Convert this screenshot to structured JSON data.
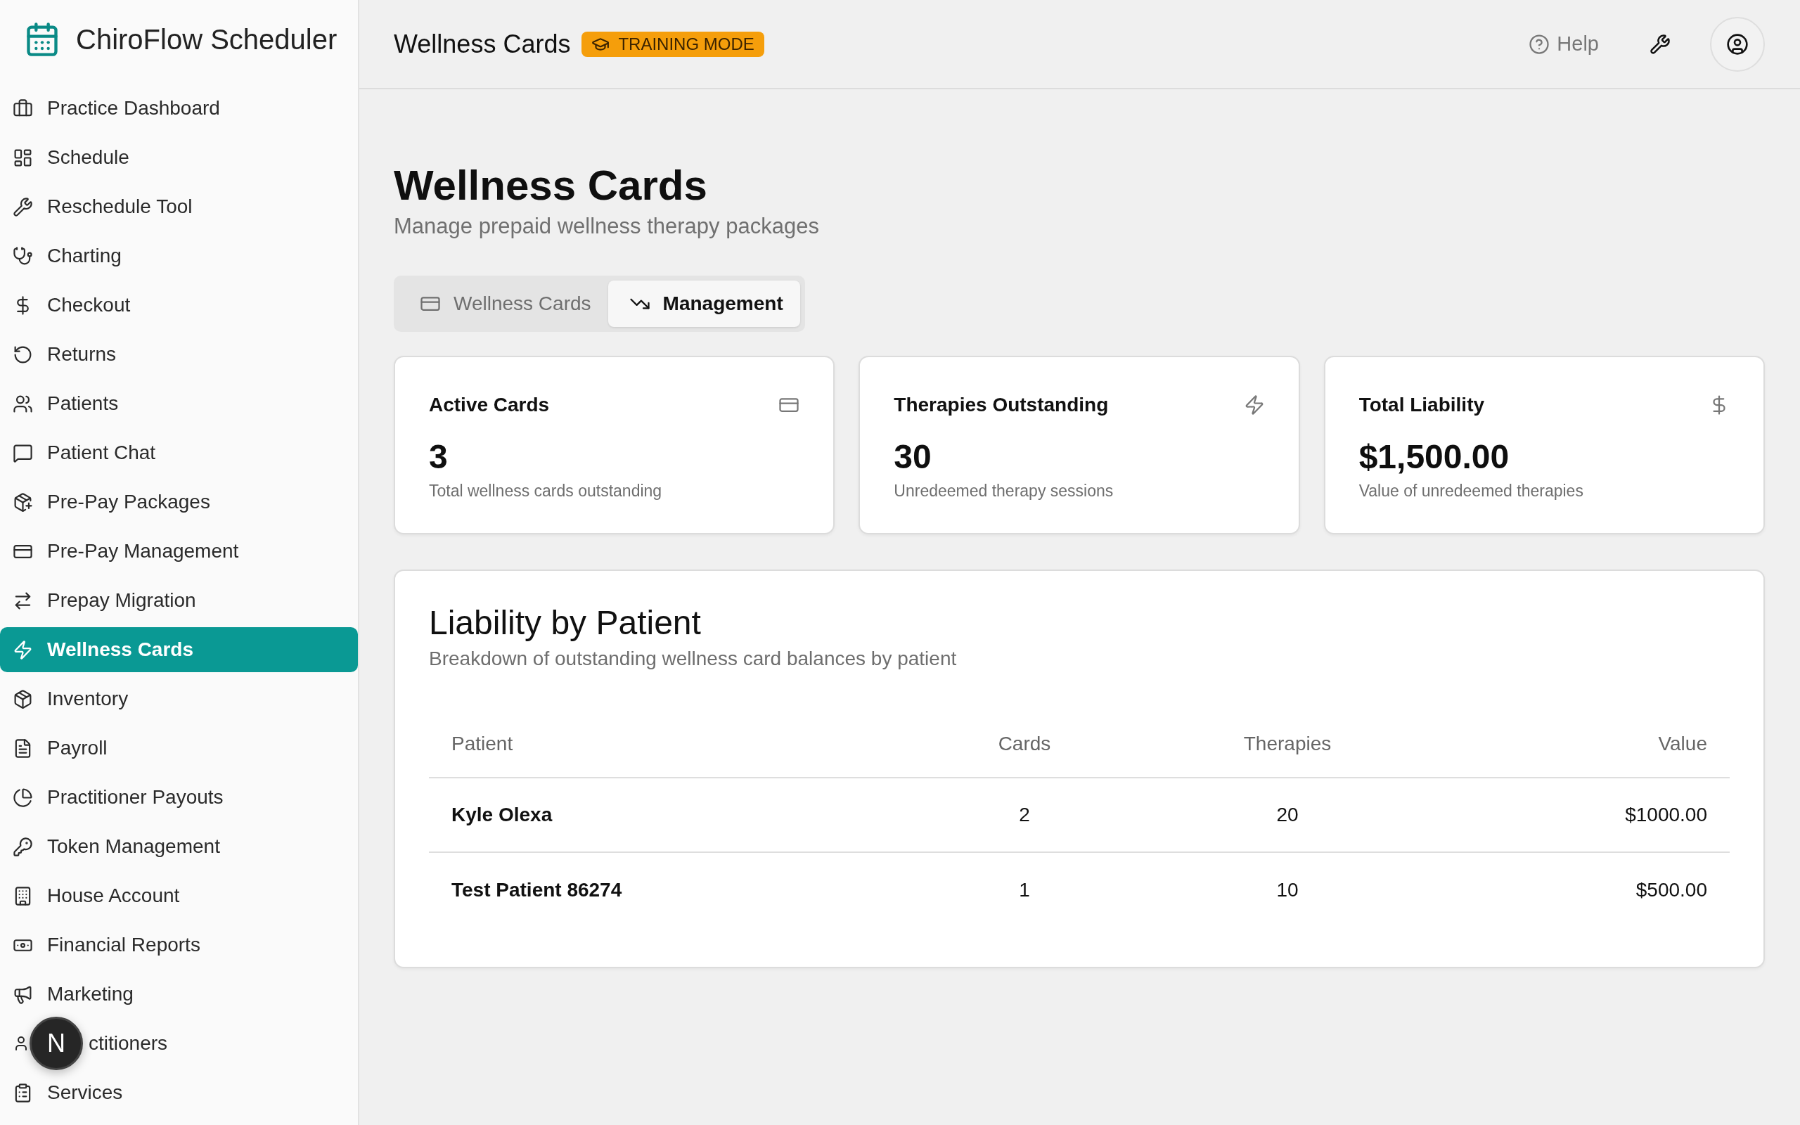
{
  "app": {
    "name": "ChiroFlow Scheduler"
  },
  "sidebar": {
    "items": [
      {
        "label": "Practice Dashboard",
        "selected": false
      },
      {
        "label": "Schedule",
        "selected": false
      },
      {
        "label": "Reschedule Tool",
        "selected": false
      },
      {
        "label": "Charting",
        "selected": false
      },
      {
        "label": "Checkout",
        "selected": false
      },
      {
        "label": "Returns",
        "selected": false
      },
      {
        "label": "Patients",
        "selected": false
      },
      {
        "label": "Patient Chat",
        "selected": false
      },
      {
        "label": "Pre-Pay Packages",
        "selected": false
      },
      {
        "label": "Pre-Pay Management",
        "selected": false
      },
      {
        "label": "Prepay Migration",
        "selected": false
      },
      {
        "label": "Wellness Cards",
        "selected": true
      },
      {
        "label": "Inventory",
        "selected": false
      },
      {
        "label": "Payroll",
        "selected": false
      },
      {
        "label": "Practitioner Payouts",
        "selected": false
      },
      {
        "label": "Token Management",
        "selected": false
      },
      {
        "label": "House Account",
        "selected": false
      },
      {
        "label": "Financial Reports",
        "selected": false
      },
      {
        "label": "Marketing",
        "selected": false
      },
      {
        "label": "ctitioners",
        "selected": false,
        "kind": "covered"
      },
      {
        "label": "Services",
        "selected": false
      }
    ]
  },
  "dev_badge": {
    "label": "N"
  },
  "header": {
    "title": "Wellness Cards",
    "badge": "TRAINING MODE",
    "help": "Help"
  },
  "page": {
    "title": "Wellness Cards",
    "subtitle": "Manage prepaid wellness therapy packages"
  },
  "tabs": [
    {
      "label": "Wellness Cards",
      "selected": false
    },
    {
      "label": "Management",
      "selected": true
    }
  ],
  "stats": [
    {
      "title": "Active Cards",
      "value": "3",
      "caption": "Total wellness cards outstanding"
    },
    {
      "title": "Therapies Outstanding",
      "value": "30",
      "caption": "Unredeemed therapy sessions"
    },
    {
      "title": "Total Liability",
      "value": "$1,500.00",
      "caption": "Value of unredeemed therapies"
    }
  ],
  "liability": {
    "title": "Liability by Patient",
    "description": "Breakdown of outstanding wellness card balances by patient",
    "columns": [
      "Patient",
      "Cards",
      "Therapies",
      "Value"
    ],
    "rows": [
      [
        "Kyle Olexa",
        "2",
        "20",
        "$1000.00"
      ],
      [
        "Test Patient 86274",
        "1",
        "10",
        "$500.00"
      ]
    ]
  }
}
